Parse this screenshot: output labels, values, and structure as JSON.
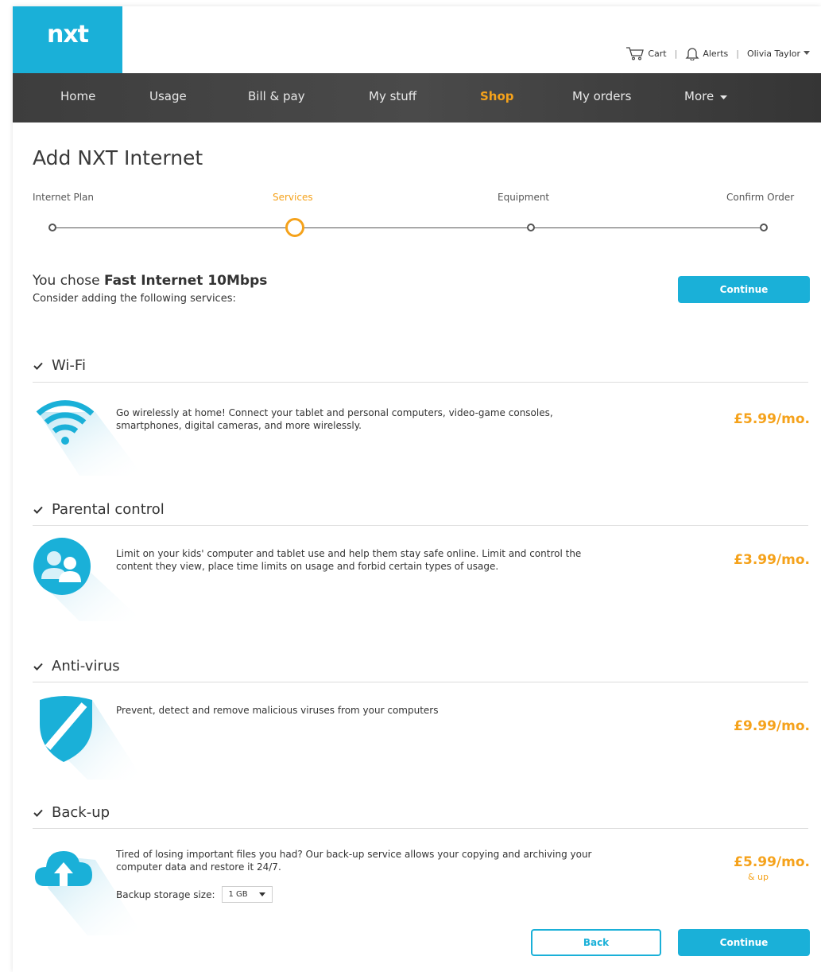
{
  "header": {
    "logo": "nxt",
    "cart_label": "Cart",
    "alerts_label": "Alerts",
    "user_label": "Olivia Taylor"
  },
  "nav": [
    {
      "label": "Home"
    },
    {
      "label": "Usage"
    },
    {
      "label": "Bill & pay"
    },
    {
      "label": "My stuff"
    },
    {
      "label": "Shop",
      "active": true
    },
    {
      "label": "My orders"
    },
    {
      "label": "More"
    }
  ],
  "page": {
    "title": "Add NXT Internet",
    "chose_prefix": "You chose ",
    "chose_plan": "Fast Internet 10Mbps",
    "consider": "Consider adding the following services:",
    "continue_label": "Continue",
    "back_label": "Back"
  },
  "steps": [
    {
      "label": "Internet Plan"
    },
    {
      "label": "Services",
      "active": true
    },
    {
      "label": "Equipment"
    },
    {
      "label": "Confirm Order"
    }
  ],
  "services": [
    {
      "name": "Wi-Fi",
      "icon": "wifi-icon",
      "description": "Go wirelessly at home! Connect your tablet and personal computers, video-game consoles, smartphones, digital cameras, and more wirelessly.",
      "price": "£5.99/mo.",
      "checked": true
    },
    {
      "name": "Parental control",
      "icon": "parental-control-icon",
      "description": "Limit on your kids' computer and tablet use and help them stay safe online. Limit and control the content they view, place time limits on usage and forbid certain types of usage.",
      "price": "£3.99/mo.",
      "checked": true
    },
    {
      "name": "Anti-virus",
      "icon": "shield-icon",
      "description": "Prevent, detect and remove malicious viruses from your computers",
      "price": "£9.99/mo.",
      "checked": true
    },
    {
      "name": "Back-up",
      "icon": "cloud-upload-icon",
      "description": "Tired of losing important files you had? Our back-up service allows your copying and archiving your computer data and restore it 24/7.",
      "price": "£5.99/mo.",
      "price_note": "& up",
      "checked": true
    }
  ],
  "backup": {
    "storage_label": "Backup storage size:",
    "storage_value": "1 GB"
  },
  "colors": {
    "brand": "#1ab0d8",
    "accent": "#f5a21b",
    "nav_bg": "#444444"
  }
}
